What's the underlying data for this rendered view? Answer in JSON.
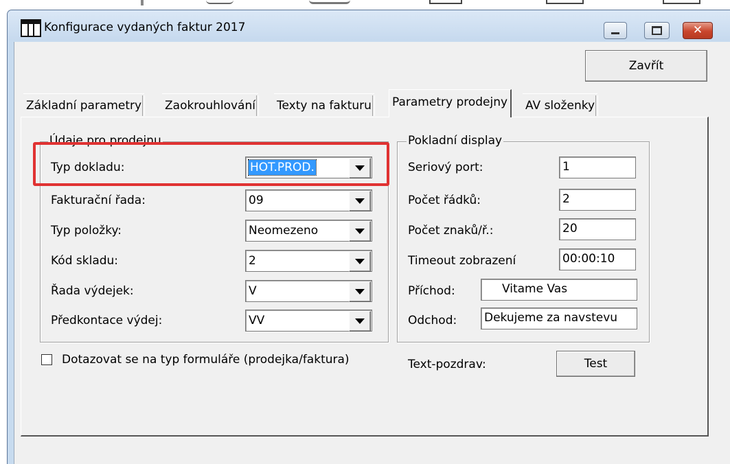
{
  "window": {
    "title": "Konfigurace vydaných faktur  2017",
    "close_glyph": "✕"
  },
  "toolbar": {
    "close_label": "Zavřít"
  },
  "tabs": [
    {
      "label": "Základní parametry",
      "active": false
    },
    {
      "label": "Zaokrouhlování",
      "active": false
    },
    {
      "label": "Texty na fakturu",
      "active": false
    },
    {
      "label": "Parametry prodejny",
      "active": true
    },
    {
      "label": "AV složenky",
      "active": false
    }
  ],
  "sales_group": {
    "title": "Údaje pro prodejnu",
    "fields": [
      {
        "label": "Typ dokladu:",
        "value": "HOT.PROD."
      },
      {
        "label": "Fakturační  řada:",
        "value": "09"
      },
      {
        "label": "Typ položky:",
        "value": "Neomezeno"
      },
      {
        "label": "Kód skladu:",
        "value": "2"
      },
      {
        "label": "Řada výdejek:",
        "value": "V"
      },
      {
        "label": "Předkontace výdej:",
        "value": "VV"
      }
    ]
  },
  "display_group": {
    "title": "Pokladní display",
    "fields": [
      {
        "label": "Seriový port:",
        "value": "1"
      },
      {
        "label": "Počet řádků:",
        "value": "2"
      },
      {
        "label": "Počet znaků/ř.:",
        "value": "20"
      },
      {
        "label": "Timeout zobrazení",
        "value": "00:00:10"
      },
      {
        "label": "Příchod:",
        "value": "Vitame Vas"
      },
      {
        "label": "Odchod:",
        "value": "Dekujeme za navstevu"
      }
    ]
  },
  "options": {
    "ask_form_type_label": "Dotazovat se na typ formuláře (prodejka/faktura)",
    "ask_form_type_checked": false
  },
  "greeting": {
    "label": "Text-pozdrav:",
    "test_label": "Test"
  },
  "colors": {
    "highlight": "#e03232",
    "selection": "#3399ff"
  }
}
